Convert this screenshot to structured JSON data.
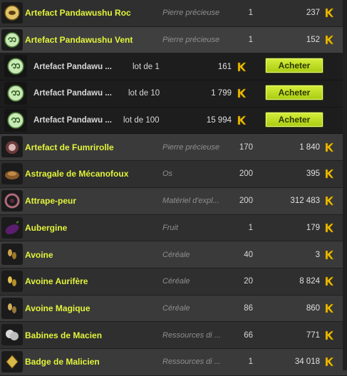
{
  "colors": {
    "name": "#e2f43c",
    "kamas": "#f2c200",
    "buy_button": "#c6e12a"
  },
  "currency_icon": "kama-icon",
  "rows": [
    {
      "name": "Artefact Pandawushu Roc",
      "category": "Pierre précieuse",
      "level": "1",
      "price": "237",
      "icon": "pandawushu-roc-icon"
    },
    {
      "name": "Artefact Pandawushu Vent",
      "category": "Pierre précieuse",
      "level": "1",
      "price": "152",
      "icon": "pandawushu-vent-icon"
    }
  ],
  "sub_rows": [
    {
      "name": "Artefact Pandawu ...",
      "lot": "lot de 1",
      "price": "161",
      "button": "Acheter"
    },
    {
      "name": "Artefact Pandawu ...",
      "lot": "lot de 10",
      "price": "1 799",
      "button": "Acheter"
    },
    {
      "name": "Artefact Pandawu ...",
      "lot": "lot de 100",
      "price": "15 994",
      "button": "Acheter"
    }
  ],
  "rows_after": [
    {
      "name": "Artefact de Fumrirolle",
      "category": "Pierre précieuse",
      "level": "170",
      "price": "1 840",
      "icon": "fumrirolle-icon"
    },
    {
      "name": "Astragale de Mécanofoux",
      "category": "Os",
      "level": "200",
      "price": "395",
      "icon": "astragale-icon"
    },
    {
      "name": "Attrape-peur",
      "category": "Matériel d'expl...",
      "level": "200",
      "price": "312 483",
      "icon": "attrape-peur-icon"
    },
    {
      "name": "Aubergine",
      "category": "Fruit",
      "level": "1",
      "price": "179",
      "icon": "aubergine-icon"
    },
    {
      "name": "Avoine",
      "category": "Céréale",
      "level": "40",
      "price": "3",
      "icon": "avoine-icon"
    },
    {
      "name": "Avoine Aurifère",
      "category": "Céréale",
      "level": "20",
      "price": "8 824",
      "icon": "avoine-aurifere-icon"
    },
    {
      "name": "Avoine Magique",
      "category": "Céréale",
      "level": "86",
      "price": "860",
      "icon": "avoine-magique-icon"
    },
    {
      "name": "Babines de Macien",
      "category": "Ressources di ...",
      "level": "66",
      "price": "771",
      "icon": "babines-icon"
    },
    {
      "name": "Badge de Malicien",
      "category": "Ressources di ...",
      "level": "1",
      "price": "34 018",
      "icon": "badge-icon"
    }
  ]
}
